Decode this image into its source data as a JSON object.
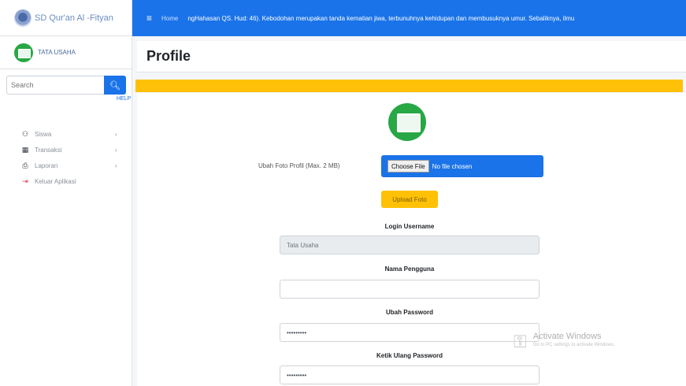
{
  "sidebar": {
    "brand": "SD Qur'an Al -Fityan",
    "user_name": "TATA USAHA",
    "search_placeholder": "Search",
    "help_text": "HELP",
    "items": [
      {
        "label": "Siswa",
        "icon": "users-icon",
        "glyph": "⚇"
      },
      {
        "label": "Transaksi",
        "icon": "table-icon",
        "glyph": "▦"
      },
      {
        "label": "Laporan",
        "icon": "print-icon",
        "glyph": "⎙"
      },
      {
        "label": "Keluar Aplikasi",
        "icon": "logout-icon",
        "glyph": "⇥"
      }
    ]
  },
  "topbar": {
    "menu_glyph": "≡",
    "home_link": "Home",
    "marquee": "ngHahasan QS. Hud: 46). Kebodohan merupakan tanda kematian jiwa, terbunuhnya kehidupan dan membusuknya umur. Sebaliknya, ilmu"
  },
  "page": {
    "title": "Profile"
  },
  "form": {
    "photo_label": "Ubah Foto Profil (Max. 2 MB)",
    "file_button": "Choose File",
    "file_status": "No file chosen",
    "upload_button": "Upload Foto",
    "login_label": "Login Username",
    "login_value": "Tata Usaha",
    "name_label": "Nama Pengguna",
    "name_value": "",
    "password_label": "Ubah Password",
    "password_value": "•••••••••",
    "confirm_label": "Ketik Ulang Password",
    "confirm_value": "•••••••••"
  },
  "watermark": {
    "title": "Activate Windows",
    "subtitle": "Go to PC settings to activate Windows."
  },
  "colors": {
    "primary": "#1a73e8",
    "warning": "#ffc107",
    "success": "#28a745"
  }
}
